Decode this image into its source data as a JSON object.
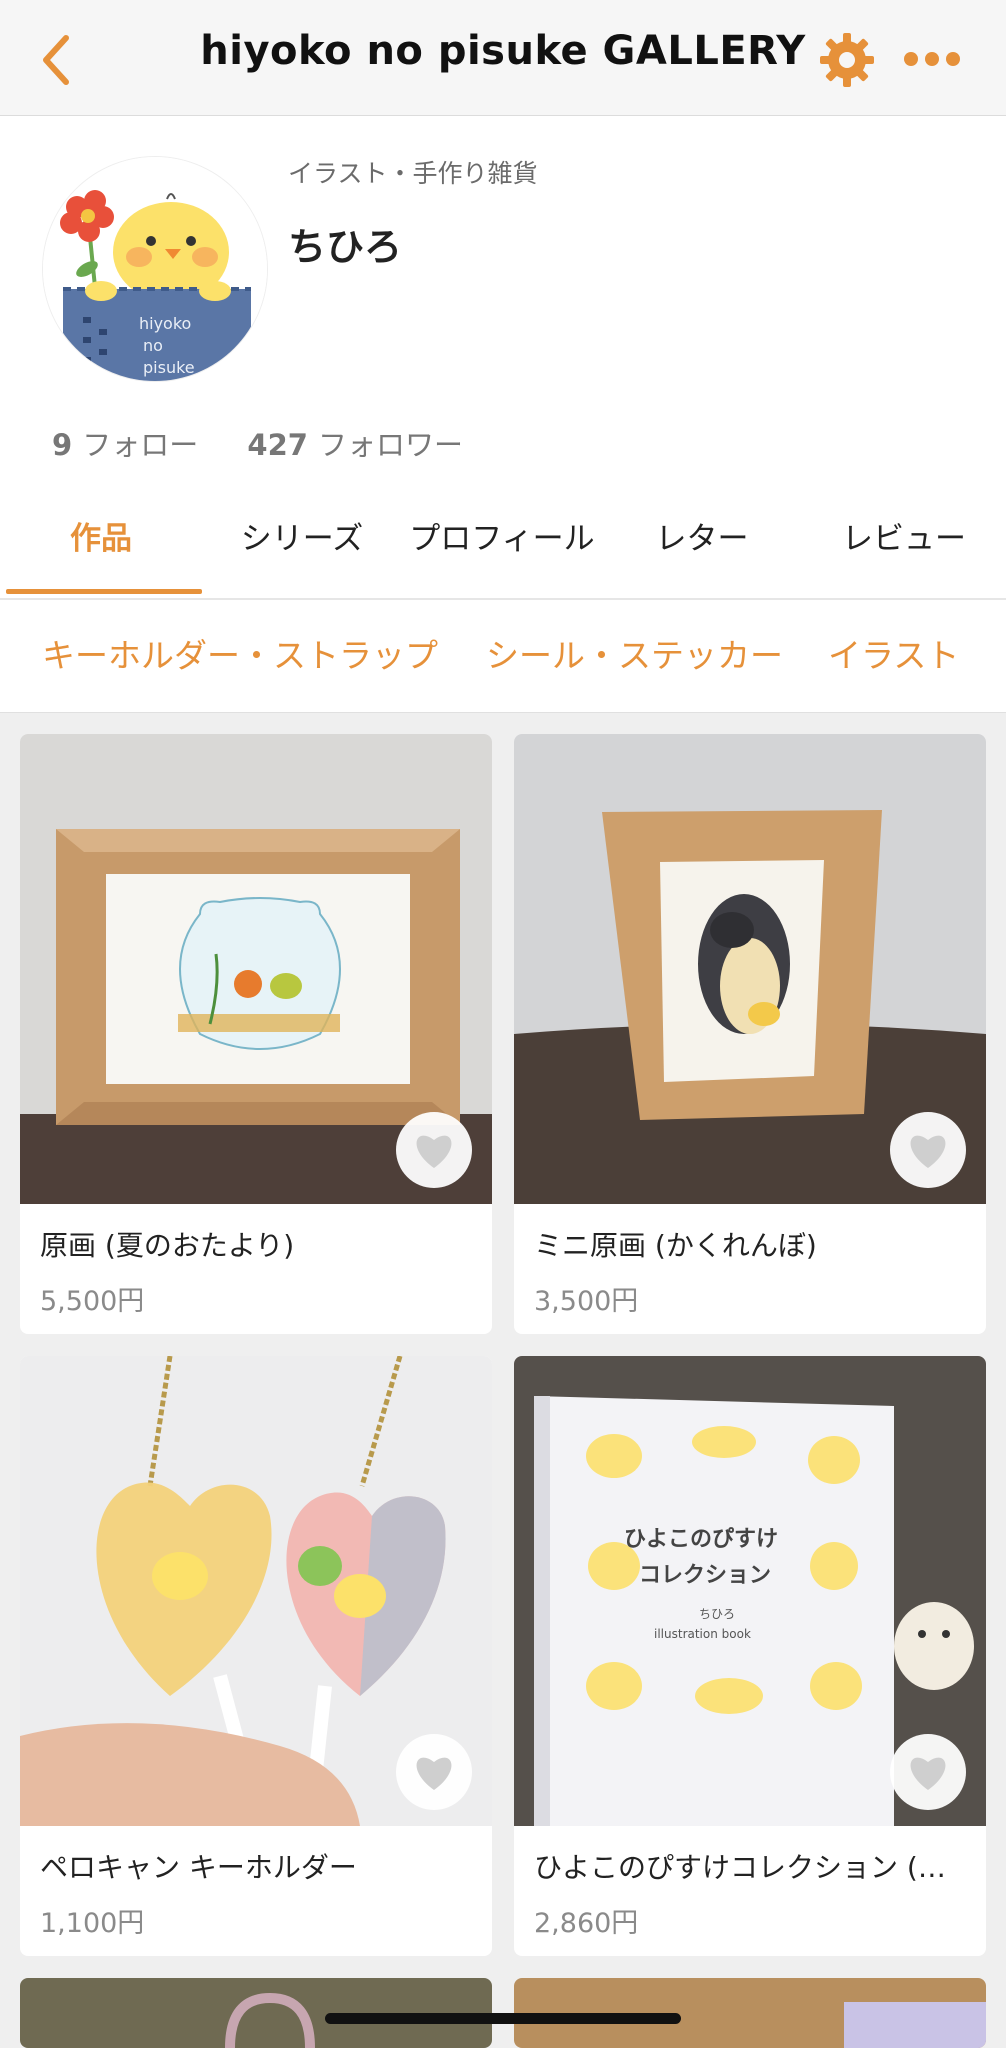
{
  "header": {
    "title": "hiyoko no pisuke GALLERY",
    "back_icon": "chevron-left-icon",
    "settings_icon": "gear-icon",
    "more_icon": "more-dots-icon",
    "accent": "#e6913a"
  },
  "profile": {
    "category": "イラスト・手作り雑貨",
    "name": "ちひろ",
    "avatar_text": [
      "hiyoko",
      "no",
      "pisuke"
    ],
    "follow_count": "9",
    "follow_label": "フォロー",
    "follower_count": "427",
    "follower_label": "フォロワー"
  },
  "tabs": [
    {
      "label": "作品",
      "active": true
    },
    {
      "label": "シリーズ"
    },
    {
      "label": "プロフィール"
    },
    {
      "label": "レター"
    },
    {
      "label": "レビュー"
    }
  ],
  "categories": [
    "キーホルダー・ストラップ",
    "シール・ステッカー",
    "イラスト"
  ],
  "products": [
    {
      "title": "原画 (夏のおたより)",
      "price": "5,500円"
    },
    {
      "title": "ミニ原画 (かくれんぼ)",
      "price": "3,500円"
    },
    {
      "title": "ペロキャン キーホルダー",
      "price": "1,100円"
    },
    {
      "title": "ひよこのぴすけコレクション (…",
      "price": "2,860円"
    }
  ],
  "book_cover": {
    "title_line1": "ひよこのぴすけ",
    "title_line2": "コレクション",
    "author": "ちひろ",
    "subtitle": "illustration book"
  }
}
